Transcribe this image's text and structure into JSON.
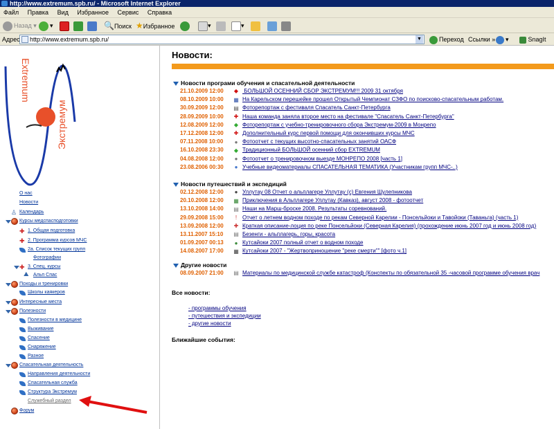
{
  "window": {
    "title": "http://www.extremum.spb.ru/ - Microsoft Internet Explorer"
  },
  "menu": [
    "Файл",
    "Правка",
    "Вид",
    "Избранное",
    "Сервис",
    "Справка"
  ],
  "toolbar": {
    "back": "Назад",
    "search": "Поиск",
    "favorites": "Избранное",
    "go": "Переход",
    "links": "Ссылки",
    "snagit": "SnagIt"
  },
  "address": {
    "label": "Адрес:",
    "url": "http://www.extremum.spb.ru/"
  },
  "logo": {
    "text1": "Extremum",
    "text2": "Экстремум"
  },
  "sidebar": {
    "items": [
      {
        "label": "О нас",
        "level": 0
      },
      {
        "label": "Новости",
        "level": 0
      },
      {
        "label": "Календарь",
        "level": 0
      },
      {
        "label": "Курсы медспасподготовки",
        "level": 0
      },
      {
        "label": "1. Общая подготовка",
        "level": 1
      },
      {
        "label": "2. Программа курсов МЧС",
        "level": 1
      },
      {
        "label": "2а. Список текущих групп",
        "level": 1
      },
      {
        "label": "Фотографии",
        "level": 2
      },
      {
        "label": "3. Спец. курсы",
        "level": 1
      },
      {
        "label": "Альп Спас",
        "level": 2
      },
      {
        "label": "Походы и тренировки",
        "level": 0
      },
      {
        "label": "Школы каякеров",
        "level": 1
      },
      {
        "label": "Интересные места",
        "level": 0
      },
      {
        "label": "Полезности",
        "level": 0
      },
      {
        "label": "Полезности в медицине",
        "level": 1
      },
      {
        "label": "Выживание",
        "level": 1
      },
      {
        "label": "Спасение",
        "level": 1
      },
      {
        "label": "Снаряжение",
        "level": 1
      },
      {
        "label": "Разное",
        "level": 1
      },
      {
        "label": "Спасательная деятельность",
        "level": 0
      },
      {
        "label": "Направления деятельности",
        "level": 1
      },
      {
        "label": "Спасательная служба",
        "level": 1
      },
      {
        "label": "Структура Экстремум",
        "level": 1
      },
      {
        "label": "Служебный раздел",
        "level": 1
      },
      {
        "label": "Форум",
        "level": 0
      }
    ]
  },
  "main": {
    "title": "Новости:",
    "categories": [
      {
        "label": "Новости програми обучения и спасательной деятельности",
        "items": [
          {
            "date": "21.10.2009 12:00",
            "text": " БОЛЬШОЙ ОСЕННИЙ СБОР ЭКСТРЕМУМ!!! 2009 31 октября"
          },
          {
            "date": "08.10.2009 10:00",
            "text": "На Карельском перешейке прошел Открытый Чемпионат СЗФО по поисково-спасательным работам."
          },
          {
            "date": "30.09.2009 12:00",
            "text": "Фоторепортаж с фестиваля Спасатель Санкт-Петербурга"
          },
          {
            "date": "28.09.2009 10:00",
            "text": "Наша команда заняла второе место на фестивале \"Спасатель Санкт-Петербурга\""
          },
          {
            "date": "12.08.2009 12:00",
            "text": "Фоторепортаж с учебно-тренировочного сбора Экстремум-2009 в Монрепо"
          },
          {
            "date": "17.12.2008 12:00",
            "text": "Дополнительный курс первой помощи для окончивших курсы МЧС"
          },
          {
            "date": "07.11.2008 10:00",
            "text": "Фотоотчет с текущих высотно-спасательных занятий ОАСФ"
          },
          {
            "date": "16.10.2008 23:30",
            "text": "Традиционный БОЛЬШОЙ осенний сбор EXTREMUM"
          },
          {
            "date": "04.08.2008 12:00",
            "text": "Фотоотчет о тренировочном выезде МОНРЕПО 2008 [часть 1]"
          },
          {
            "date": "23.08.2006 00:30",
            "text": "Учебные видеоматериалы СПАСАТЕЛЬНАЯ ТЕМАТИКА (Участникам групп МЧС-..)"
          }
        ]
      },
      {
        "label": "Новости путешествий и экспедиций",
        "items": [
          {
            "date": "02.12.2008 12:00",
            "text": "Уллутау 08 Отчет о альплагере Уллутау (с) Евгения Шулепникова"
          },
          {
            "date": "20.10.2008 12:00",
            "text": "Приключения в Альплагере Уллутау (Кавказ), август 2008 - фотоотчет"
          },
          {
            "date": "13.10.2008 14:00",
            "text": "Наши на Марш-броске 2008. Результаты соревнований."
          },
          {
            "date": "29.09.2008 15:00",
            "text": "Отчет о летнем водном походе по рекам Северной Карелии - Понсельйоки и Тавойоки (Таваньга) (часть 1)"
          },
          {
            "date": "13.09.2008 12:00",
            "text": "Краткая описание-лоция по реке Понсельйоки (Северная Карелия) (прохождение июнь 2007 год и июнь 2008 год)"
          },
          {
            "date": "13.11.2007 15:10",
            "text": "Безенги - альплагерь, горы, красота"
          },
          {
            "date": "01.09.2007 00:13",
            "text": "Кутсайоки 2007 полный отчет о водном походе"
          },
          {
            "date": "14.08.2007 17:00",
            "text": "Кутсайоки 2007 - \"Жертвоприношение \"реке смерти\"\" [фото ч.1]"
          }
        ]
      },
      {
        "label": "Другие новости",
        "items": [
          {
            "date": "08.09.2007 21:00",
            "text": "Материалы по медицинской службе катастроф (Конспекты по обязательной 35 -часовой программе обучения врач"
          }
        ]
      }
    ],
    "all_news_label": "Все новости:",
    "all_news_links": [
      "- программы обучения",
      "- путешествия и экспедиции",
      "- другие новости"
    ],
    "upcoming_label": "Ближайшие события:"
  },
  "colors": {
    "accent_orange": "#f39a1c",
    "date_orange": "#e06000",
    "link_blue": "#000080",
    "arrow_red": "#e01010",
    "title_bar": "#0a246a"
  }
}
